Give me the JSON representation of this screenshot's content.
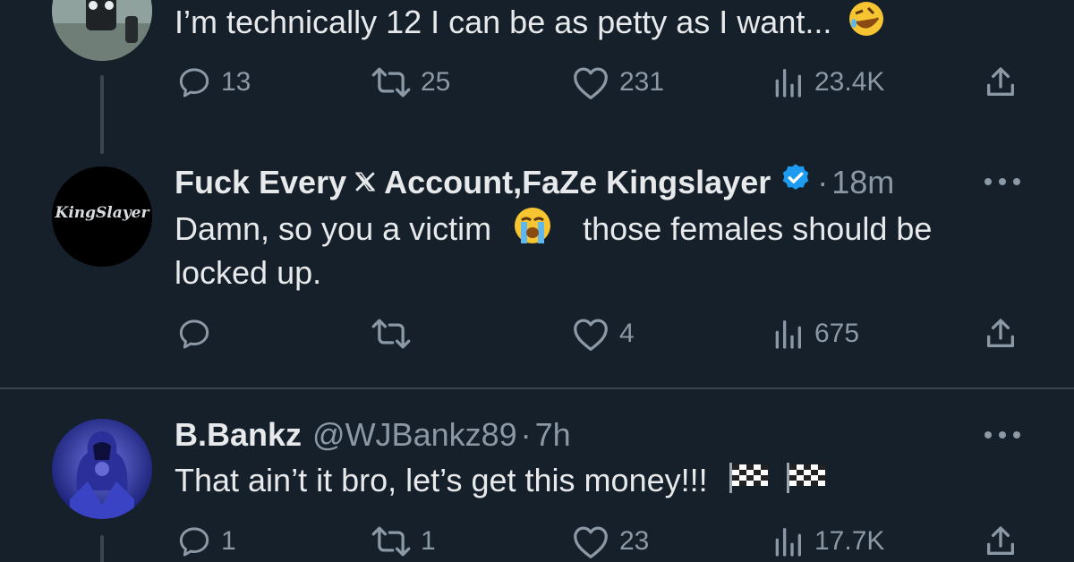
{
  "tweets": [
    {
      "text": "I’m technically 12 I can be as petty as I want...",
      "emoji": "rolling-on-floor-laughing",
      "replies": "13",
      "reposts": "25",
      "likes": "231",
      "views": "23.4K"
    },
    {
      "name_part1": "Fuck Every",
      "name_part2": "Account,FaZe Kingslayer",
      "separator": "·",
      "time": "18m",
      "avatar_text": "KingSlayer",
      "text_before_emoji": "Damn, so you a victim",
      "text_after_emoji": "those females should be",
      "text_line2": "locked up.",
      "emoji": "loudly-crying-face",
      "replies": "",
      "reposts": "",
      "likes": "4",
      "views": "675"
    },
    {
      "name": "B.Bankz",
      "handle": "@WJBankz89",
      "separator": "·",
      "time": "7h",
      "text": "That ain’t it bro, let’s get this money!!!",
      "emoji": "chequered-flag",
      "replies": "1",
      "reposts": "1",
      "likes": "23",
      "views": "17.7K"
    }
  ],
  "colors": {
    "background": "#15202b",
    "text": "#e7e9ea",
    "muted": "#8b98a5",
    "verified": "#1d9bf0",
    "divider": "#38444d"
  }
}
